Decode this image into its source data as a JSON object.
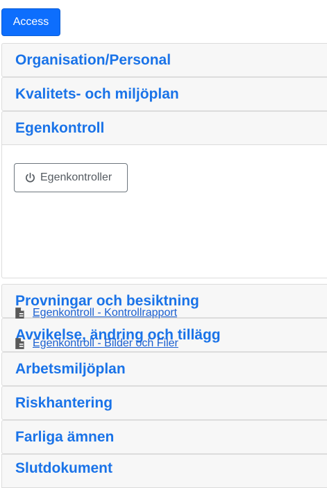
{
  "access_button": {
    "label": "Access"
  },
  "sections": [
    {
      "title": "Organisation/Personal"
    },
    {
      "title": "Kvalitets- och miljöplan"
    },
    {
      "title": "Egenkontroll"
    },
    {
      "title": "Provningar och besiktning"
    },
    {
      "title": "Avvikelse, ändring och tillägg"
    },
    {
      "title": "Arbetsmiljöplan"
    },
    {
      "title": "Riskhantering"
    },
    {
      "title": "Farliga ämnen"
    },
    {
      "title": "Slutdokument"
    }
  ],
  "egenkontroll": {
    "button_label": "Egenkontroller",
    "button_icon": "power-icon",
    "links": [
      {
        "label": "Egenkontroll - Kontrollrapport",
        "icon": "document-icon"
      },
      {
        "label": "Egenkontroll - Bilder och Filer",
        "icon": "document-icon"
      }
    ]
  },
  "colors": {
    "primary": "#0d6efd",
    "header_text": "#1a73e8",
    "link": "#1a5fd0",
    "header_bg": "#f7f7f7"
  }
}
